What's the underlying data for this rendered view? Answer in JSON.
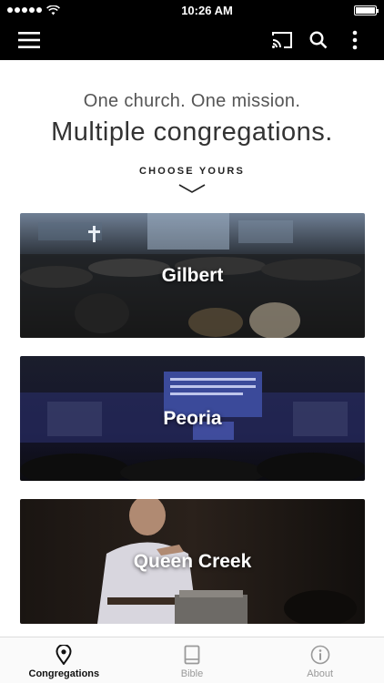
{
  "status_bar": {
    "time": "10:26 AM"
  },
  "app_bar": {
    "menu_icon": "hamburger-menu-icon",
    "cast_icon": "cast-icon",
    "search_icon": "search-icon",
    "more_icon": "more-vertical-icon"
  },
  "intro": {
    "tagline": "One church. One mission.",
    "headline": "Multiple congregations.",
    "cta": "CHOOSE YOURS",
    "chevron_icon": "chevron-down-icon"
  },
  "congregations": [
    {
      "label": "Gilbert"
    },
    {
      "label": "Peoria"
    },
    {
      "label": "Queen Creek"
    }
  ],
  "tabs": [
    {
      "label": "Congregations",
      "icon": "map-pin-icon",
      "active": true
    },
    {
      "label": "Bible",
      "icon": "book-icon",
      "active": false
    },
    {
      "label": "About",
      "icon": "info-icon",
      "active": false
    }
  ],
  "colors": {
    "bar": "#000000",
    "active_tab": "#111111",
    "inactive_tab": "#999999"
  }
}
